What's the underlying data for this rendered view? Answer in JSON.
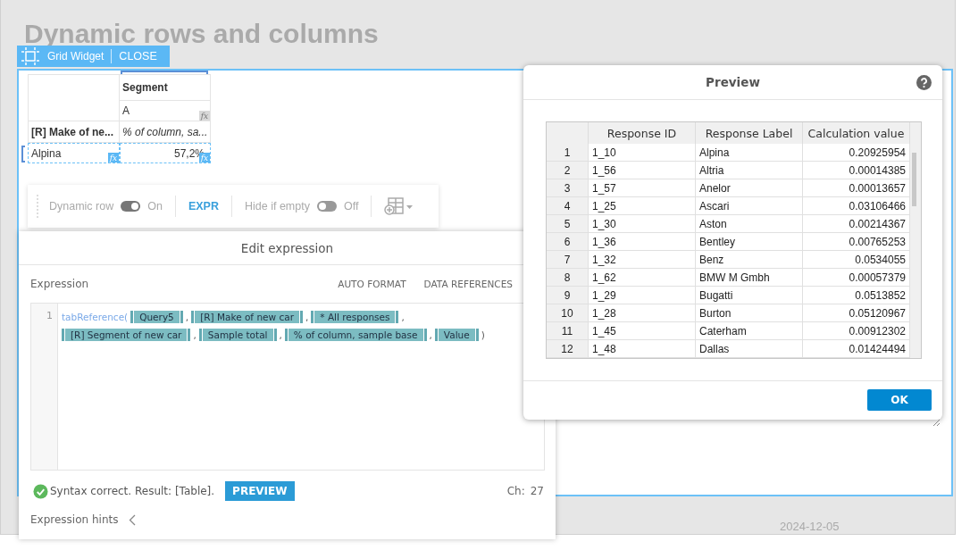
{
  "page": {
    "title": "Dynamic rows and columns",
    "footer_date": "2024-12-05"
  },
  "widget": {
    "label": "Grid Widget",
    "close": "CLOSE"
  },
  "grid": {
    "column_header": "Segment",
    "column_sub": "A",
    "column_sub_fx": "fx",
    "row_header": "[R] Make of ne...",
    "measure": "% of column, sa...",
    "row_label": "Alpina",
    "row_label_fx": "fx",
    "value": "57,2%",
    "value_fx": "fx"
  },
  "toolbar": {
    "dynamic_row": {
      "label": "Dynamic row",
      "on": true,
      "state_text": "On"
    },
    "expr": "EXPR",
    "hide_if_empty": {
      "label": "Hide if empty",
      "on": false,
      "state_text": "Off"
    }
  },
  "editor": {
    "title": "Edit expression",
    "section": "Expression",
    "actions": [
      "AUTO FORMAT",
      "DATA REFERENCES"
    ],
    "lines": [
      {
        "number": "1",
        "parts": [
          {
            "kind": "function",
            "text": "tabReference("
          },
          {
            "kind": "token",
            "text": "Query5"
          },
          {
            "kind": "sep",
            "text": ","
          },
          {
            "kind": "token",
            "text": "[R] Make of new car"
          },
          {
            "kind": "sep",
            "text": ","
          },
          {
            "kind": "token",
            "text": "* All responses"
          },
          {
            "kind": "sep",
            "text": ","
          }
        ]
      },
      {
        "parts": [
          {
            "kind": "token",
            "text": "[R] Segment of new car"
          },
          {
            "kind": "sep",
            "text": ","
          },
          {
            "kind": "token",
            "text": "Sample total"
          },
          {
            "kind": "sep",
            "text": ","
          },
          {
            "kind": "token",
            "text": "% of column, sample base"
          },
          {
            "kind": "sep",
            "text": ","
          },
          {
            "kind": "token",
            "text": "Value"
          },
          {
            "kind": "sep",
            "text": ")"
          }
        ]
      }
    ],
    "status": "Syntax correct. Result: [Table].",
    "preview_button": "PREVIEW",
    "char_label": "Ch:",
    "char_count": "27",
    "hints": "Expression hints"
  },
  "preview": {
    "title": "Preview",
    "columns": [
      "Response ID",
      "Response Label",
      "Calculation value"
    ],
    "rows": [
      {
        "index": "1",
        "id": "1_10",
        "label": "Alpina",
        "value": "0.20925954"
      },
      {
        "index": "2",
        "id": "1_56",
        "label": "Altria",
        "value": "0.00014385"
      },
      {
        "index": "3",
        "id": "1_57",
        "label": "Anelor",
        "value": "0.00013657"
      },
      {
        "index": "4",
        "id": "1_25",
        "label": "Ascari",
        "value": "0.03106466"
      },
      {
        "index": "5",
        "id": "1_30",
        "label": "Aston",
        "value": "0.00214367"
      },
      {
        "index": "6",
        "id": "1_36",
        "label": "Bentley",
        "value": "0.00765253"
      },
      {
        "index": "7",
        "id": "1_32",
        "label": "Benz",
        "value": "0.0534055"
      },
      {
        "index": "8",
        "id": "1_62",
        "label": "BMW M Gmbh",
        "value": "0.00057379"
      },
      {
        "index": "9",
        "id": "1_29",
        "label": "Bugatti",
        "value": "0.0513852"
      },
      {
        "index": "10",
        "id": "1_28",
        "label": "Burton",
        "value": "0.05120967"
      },
      {
        "index": "11",
        "id": "1_45",
        "label": "Caterham",
        "value": "0.00912302"
      },
      {
        "index": "12",
        "id": "1_48",
        "label": "Dallas",
        "value": "0.01424494"
      }
    ],
    "ok_button": "OK"
  }
}
